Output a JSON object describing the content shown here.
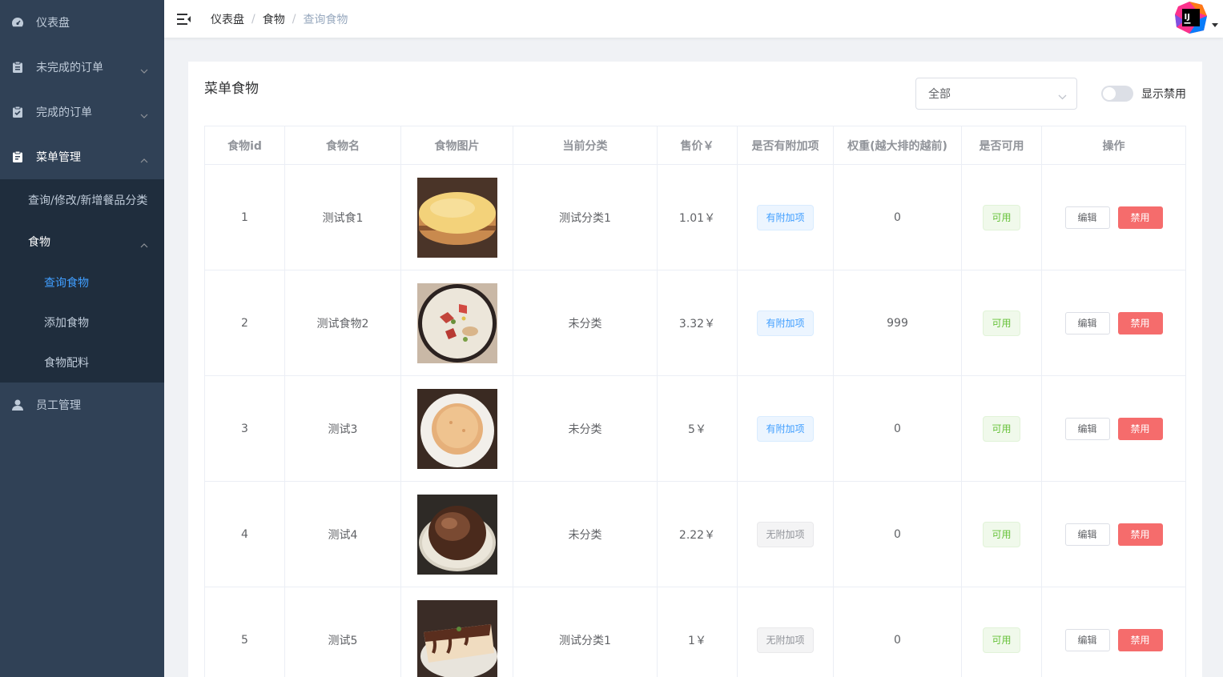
{
  "sidebar": {
    "items": [
      {
        "label": "仪表盘",
        "icon": "dashboard-icon"
      },
      {
        "label": "未完成的订单",
        "icon": "clipboard-icon"
      },
      {
        "label": "完成的订单",
        "icon": "clipboard-check-icon"
      },
      {
        "label": "菜单管理",
        "icon": "clipboard-menu-icon"
      },
      {
        "label": "员工管理",
        "icon": "user-icon"
      }
    ],
    "menu_sub": {
      "category": "查询/修改/新增餐品分类",
      "food": "食物",
      "food_children": [
        "查询食物",
        "添加食物",
        "食物配料"
      ]
    }
  },
  "navbar": {
    "breadcrumb": [
      "仪表盘",
      "食物",
      "查询食物"
    ],
    "avatar": "IJ"
  },
  "card": {
    "title": "菜单食物",
    "select_value": "全部",
    "switch_label": "显示禁用",
    "switch_on": false
  },
  "table": {
    "headers": [
      "食物id",
      "食物名",
      "食物图片",
      "当前分类",
      "售价￥",
      "是否有附加项",
      "权重(越大排的越前)",
      "是否可用",
      "操作"
    ],
    "edit_label": "编辑",
    "ban_label": "禁用",
    "rows": [
      {
        "id": "1",
        "name": "测试食1",
        "image": "cake-photo",
        "category": "测试分类1",
        "price": "1.01￥",
        "addon": "有附加项",
        "weight": "0",
        "available": "可用"
      },
      {
        "id": "2",
        "name": "测试食物2",
        "image": "decorated-cake-photo",
        "category": "未分类",
        "price": "3.32￥",
        "addon": "有附加项",
        "weight": "999",
        "available": "可用"
      },
      {
        "id": "3",
        "name": "测试3",
        "image": "pancake-photo",
        "category": "未分类",
        "price": "5￥",
        "addon": "有附加项",
        "weight": "0",
        "available": "可用"
      },
      {
        "id": "4",
        "name": "测试4",
        "image": "chocolate-cake-photo",
        "category": "未分类",
        "price": "2.22￥",
        "addon": "无附加项",
        "weight": "0",
        "available": "可用"
      },
      {
        "id": "5",
        "name": "测试5",
        "image": "cake-slice-photo",
        "category": "测试分类1",
        "price": "1￥",
        "addon": "无附加项",
        "weight": "0",
        "available": "可用"
      }
    ]
  },
  "colors": {
    "sidebar_bg": "#304156",
    "submenu_bg": "#1f2d3d",
    "active": "#409eff",
    "danger": "#f56c6c",
    "success": "#67c23a"
  }
}
